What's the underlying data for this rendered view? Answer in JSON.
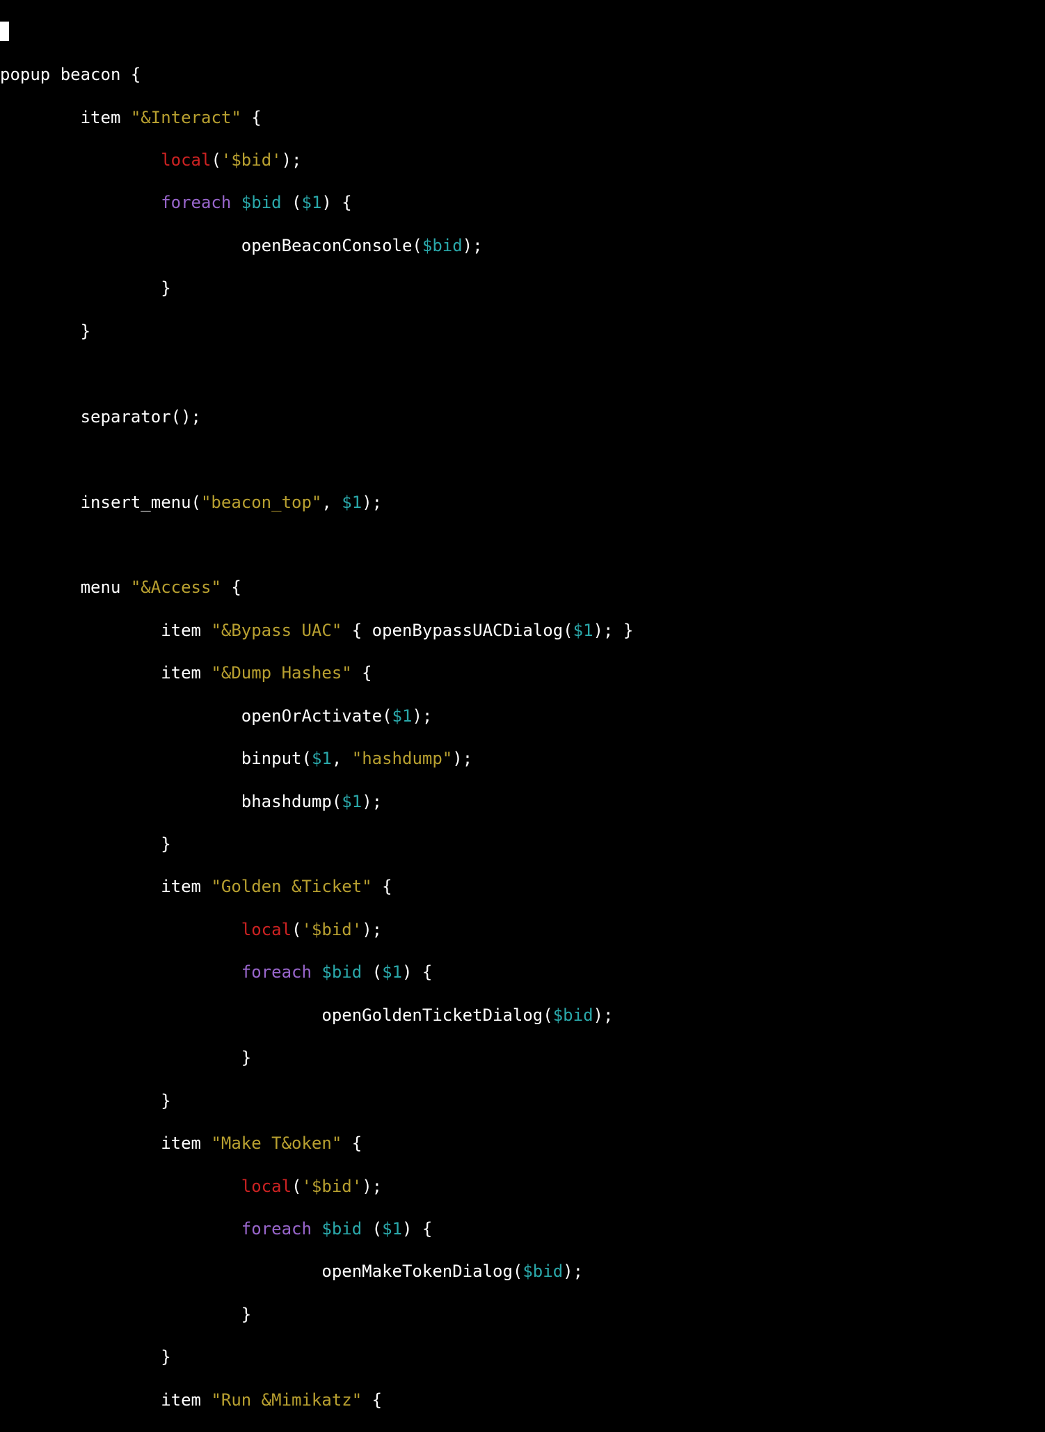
{
  "colors": {
    "background": "#000000",
    "default": "#ffffff",
    "string": "#b8a030",
    "keyword_local": "#cc2222",
    "keyword_foreach": "#9966cc",
    "variable": "#2aa8aa"
  },
  "code": {
    "l1": "popup beacon {",
    "l2": {
      "prefix": "        item ",
      "str": "\"&Interact\"",
      "suffix": " {"
    },
    "l3": {
      "indent": "                ",
      "kw": "local",
      "paren_open": "(",
      "str": "'$bid'",
      "paren_close": ");"
    },
    "l4": {
      "indent": "                ",
      "kw": "foreach",
      "mid1": " ",
      "var1": "$bid",
      "mid2": " (",
      "var2": "$1",
      "suffix": ") {"
    },
    "l5": {
      "indent": "                        ",
      "func": "openBeaconConsole(",
      "var": "$bid",
      "suffix": ");"
    },
    "l6": {
      "indent": "                ",
      "brace": "}"
    },
    "l7": {
      "indent": "        ",
      "brace": "}"
    },
    "l8": "",
    "l9": {
      "indent": "        ",
      "text": "separator();"
    },
    "l10": "",
    "l11": {
      "indent": "        ",
      "func": "insert_menu(",
      "str": "\"beacon_top\"",
      "mid": ", ",
      "var": "$1",
      "suffix": ");"
    },
    "l12": "",
    "l13": {
      "indent": "        ",
      "kw": "menu ",
      "str": "\"&Access\"",
      "suffix": " {"
    },
    "l14": {
      "indent": "                ",
      "kw": "item ",
      "str": "\"&Bypass UAC\"",
      "mid": " { openBypassUACDialog(",
      "var": "$1",
      "suffix": "); }"
    },
    "l15": {
      "indent": "                ",
      "kw": "item ",
      "str": "\"&Dump Hashes\"",
      "suffix": " {"
    },
    "l16": {
      "indent": "                        ",
      "func": "openOrActivate(",
      "var": "$1",
      "suffix": ");"
    },
    "l17": {
      "indent": "                        ",
      "func": "binput(",
      "var": "$1",
      "mid": ", ",
      "str": "\"hashdump\"",
      "suffix": ");"
    },
    "l18": {
      "indent": "                        ",
      "func": "bhashdump(",
      "var": "$1",
      "suffix": ");"
    },
    "l19": {
      "indent": "                ",
      "brace": "}"
    },
    "l20": {
      "indent": "                ",
      "kw": "item ",
      "str": "\"Golden &Ticket\"",
      "suffix": " {"
    },
    "l21": {
      "indent": "                        ",
      "kw": "local",
      "paren_open": "(",
      "str": "'$bid'",
      "paren_close": ");"
    },
    "l22": {
      "indent": "                        ",
      "kw": "foreach",
      "mid1": " ",
      "var1": "$bid",
      "mid2": " (",
      "var2": "$1",
      "suffix": ") {"
    },
    "l23": {
      "indent": "                                ",
      "func": "openGoldenTicketDialog(",
      "var": "$bid",
      "suffix": ");"
    },
    "l24": {
      "indent": "                        ",
      "brace": "}"
    },
    "l25": {
      "indent": "                ",
      "brace": "}"
    },
    "l26": {
      "indent": "                ",
      "kw": "item ",
      "str": "\"Make T&oken\"",
      "suffix": " {"
    },
    "l27": {
      "indent": "                        ",
      "kw": "local",
      "paren_open": "(",
      "str": "'$bid'",
      "paren_close": ");"
    },
    "l28": {
      "indent": "                        ",
      "kw": "foreach",
      "mid1": " ",
      "var1": "$bid",
      "mid2": " (",
      "var2": "$1",
      "suffix": ") {"
    },
    "l29": {
      "indent": "                                ",
      "func": "openMakeTokenDialog(",
      "var": "$bid",
      "suffix": ");"
    },
    "l30": {
      "indent": "                        ",
      "brace": "}"
    },
    "l31": {
      "indent": "                ",
      "brace": "}"
    },
    "l32": {
      "indent": "                ",
      "kw": "item ",
      "str": "\"Run &Mimikatz\"",
      "suffix": " {"
    }
  }
}
